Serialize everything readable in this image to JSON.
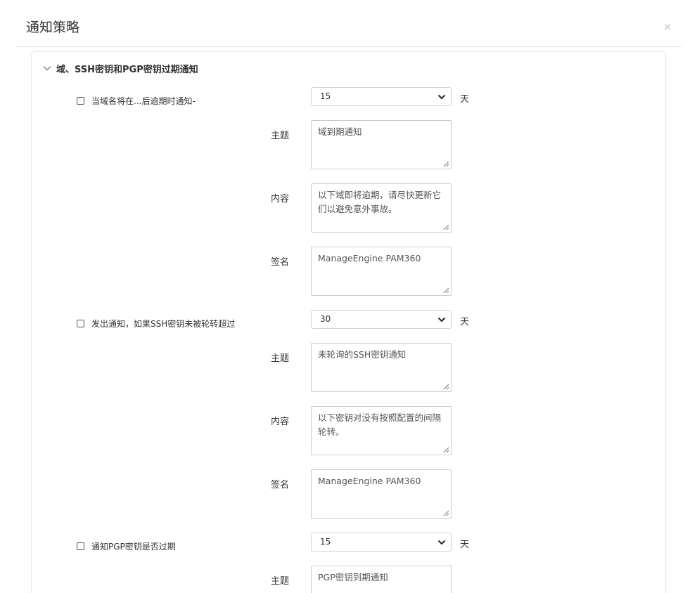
{
  "dialog": {
    "title": "通知策略",
    "close_glyph": "×"
  },
  "section": {
    "title": "域、SSH密钥和PGP密钥过期通知",
    "expanded": true
  },
  "labels": {
    "subject": "主题",
    "content": "内容",
    "signature": "签名",
    "unit_days": "天"
  },
  "notifications": [
    {
      "checkbox_label": "当域名将在...后逾期时通知-",
      "checked": false,
      "days": "15",
      "subject": "域到期通知",
      "content": "以下域即将逾期，请尽快更新它们以避免意外事故。",
      "signature": "ManageEngine PAM360"
    },
    {
      "checkbox_label": "发出通知，如果SSH密钥未被轮转超过",
      "checked": false,
      "days": "30",
      "subject": "未轮询的SSH密钥通知",
      "content": "以下密钥对没有按照配置的间隔轮转。",
      "signature": "ManageEngine PAM360"
    },
    {
      "checkbox_label": "通知PGP密钥是否过期",
      "checked": false,
      "days": "15",
      "subject": "PGP密钥到期通知"
    }
  ]
}
